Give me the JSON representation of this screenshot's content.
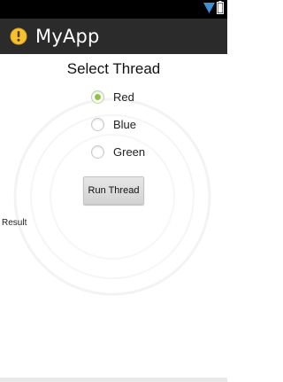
{
  "status_bar": {
    "icons": [
      "signal-icon",
      "battery-icon"
    ]
  },
  "action_bar": {
    "title": "MyApp",
    "icon": "app-icon"
  },
  "main": {
    "heading": "Select Thread",
    "radio_options": [
      {
        "label": "Red",
        "checked": true
      },
      {
        "label": "Blue",
        "checked": false
      },
      {
        "label": "Green",
        "checked": false
      }
    ],
    "run_button_label": "Run Thread",
    "result_label": "Result"
  },
  "colors": {
    "status_bar_bg": "#000000",
    "action_bar_bg": "#2b2b2b",
    "radio_checked": "#8dc63f",
    "signal_icon": "#3d8fd8"
  }
}
